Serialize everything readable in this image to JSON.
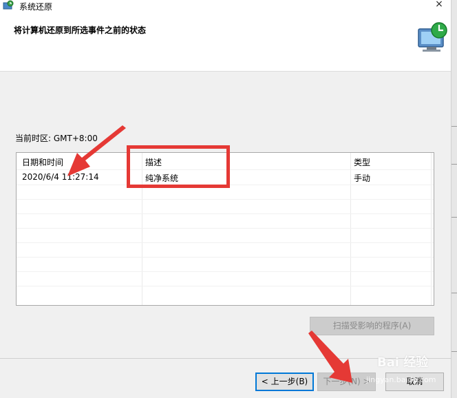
{
  "window": {
    "title": "系统还原",
    "close_glyph": "×"
  },
  "header": {
    "subtitle": "将计算机还原到所选事件之前的状态"
  },
  "timezone": {
    "text": "当前时区: GMT+8:00"
  },
  "table": {
    "columns": [
      "日期和时间",
      "描述",
      "类型"
    ],
    "rows": [
      {
        "datetime": "2020/6/4 11:27:14",
        "description": "纯净系统",
        "type": "手动"
      }
    ]
  },
  "buttons": {
    "scan": "扫描受影响的程序(A)",
    "back": "< 上一步(B)",
    "next": "下一步(N) >",
    "cancel": "取消"
  },
  "watermark": {
    "brand": "Bai 经验",
    "url": "jingyan.baidu.com"
  },
  "icons": {
    "title": "system-restore-icon",
    "header": "restore-computer-icon",
    "close": "close-icon"
  },
  "colors": {
    "annotation": "#e53935",
    "focus": "#0078d7"
  }
}
